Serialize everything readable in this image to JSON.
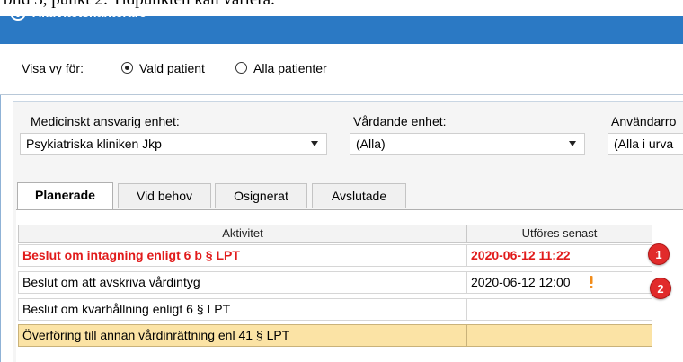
{
  "caption": "bild 3, punkt 2: Tidpunkten kan variera.",
  "window": {
    "title": "Aktivitetshanterare",
    "accent": "#2b79c4"
  },
  "view": {
    "label": "Visa vy för:",
    "options": [
      {
        "label": "Vald patient",
        "selected": true
      },
      {
        "label": "Alla patienter",
        "selected": false
      }
    ]
  },
  "filters": [
    {
      "label": "Medicinskt ansvarig enhet:",
      "value": "Psykiatriska kliniken Jkp"
    },
    {
      "label": "Vårdande enhet:",
      "value": "(Alla)"
    },
    {
      "label": "Användarro",
      "value": "(Alla i urva"
    }
  ],
  "tabs": [
    "Planerade",
    "Vid behov",
    "Osignerat",
    "Avslutade"
  ],
  "active_tab": "Planerade",
  "table": {
    "columns": [
      "Aktivitet",
      "Utföres senast"
    ],
    "rows": [
      {
        "activity": "Beslut om intagning enligt 6 b § LPT",
        "deadline": "2020-06-12 11:22",
        "style": "red"
      },
      {
        "activity": "Beslut om att avskriva vårdintyg",
        "deadline": "2020-06-12 12:00",
        "style": "normal",
        "warning": true
      },
      {
        "activity": "Beslut om kvarhållning enligt 6 § LPT",
        "deadline": "",
        "style": "normal"
      },
      {
        "activity": "Överföring till annan vårdinrättning enl 41 § LPT",
        "deadline": "",
        "style": "highlight"
      }
    ]
  },
  "badges": [
    "1",
    "2"
  ],
  "colors": {
    "overdue": "#e11b1b",
    "highlight_row": "#fbe3a5",
    "badge": "#e12b2b",
    "warning": "#f28c1a"
  }
}
